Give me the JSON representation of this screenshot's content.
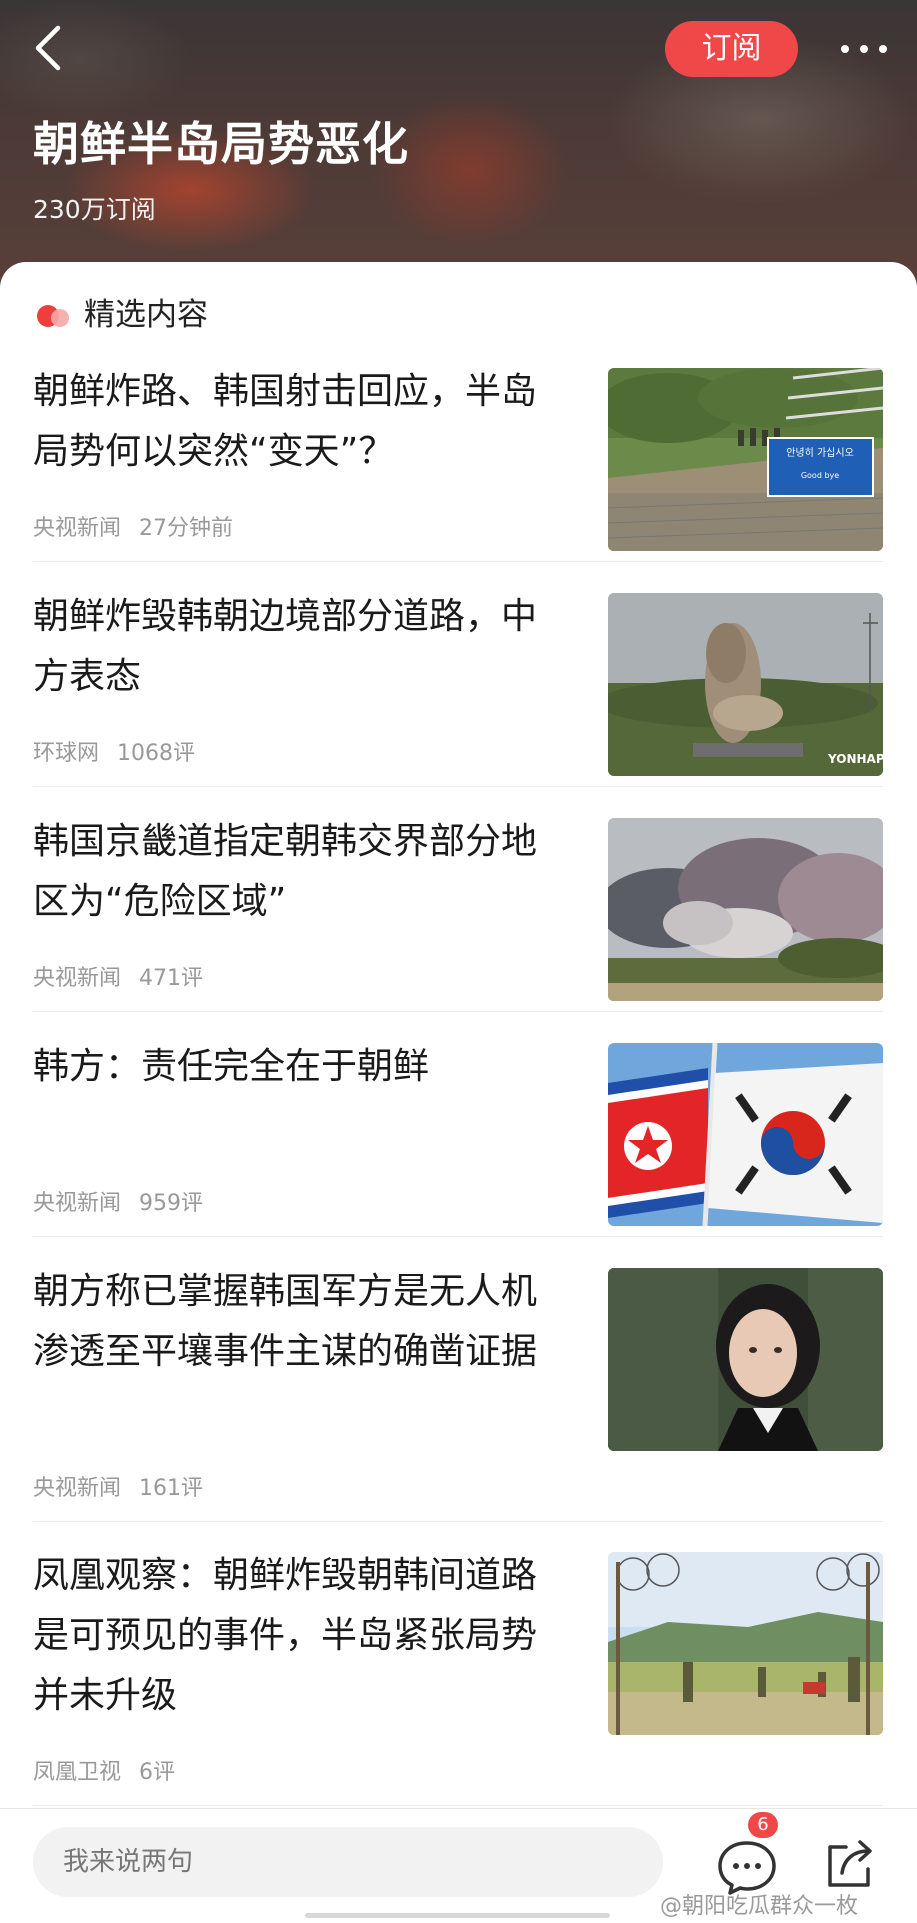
{
  "header": {
    "title": "朝鲜半岛局势恶化",
    "subscribers": "230万订阅",
    "subscribe_label": "订阅",
    "back_icon": "chevron-left-icon",
    "more_icon": "more-horizontal-icon"
  },
  "section": {
    "label": "精选内容",
    "icon": "featured-dots-icon"
  },
  "news": [
    {
      "title": "朝鲜炸路、韩国射击回应，半岛局势何以突然“变天”？",
      "source": "央视新闻",
      "meta": "27分钟前"
    },
    {
      "title": "朝鲜炸毁韩朝边境部分道路，中方表态",
      "source": "环球网",
      "meta": "1068评"
    },
    {
      "title": "韩国京畿道指定朝韩交界部分地区为“危险区域”",
      "source": "央视新闻",
      "meta": "471评"
    },
    {
      "title": "韩方：责任完全在于朝鲜",
      "source": "央视新闻",
      "meta": "959评"
    },
    {
      "title": "朝方称已掌握韩国军方是无人机渗透至平壤事件主谋的确凿证据",
      "source": "央视新闻",
      "meta": "161评"
    },
    {
      "title": "凤凰观察：朝鲜炸毁朝韩间道路是可预见的事件，半岛紧张局势并未升级",
      "source": "凤凰卫视",
      "meta": "6评"
    }
  ],
  "thumbs": {
    "sign_text_1": "안녕히 가십시오",
    "sign_text_2": "Good bye",
    "yonhap": "YONHAP"
  },
  "bottom": {
    "placeholder": "我来说两句",
    "comment_count": "6",
    "comment_icon": "comment-bubble-icon",
    "share_icon": "share-icon"
  },
  "watermark": "@朝阳吃瓜群众一枚",
  "colors": {
    "accent": "#f04848",
    "header_bg": "#3f3838",
    "meta_text": "#999999"
  }
}
